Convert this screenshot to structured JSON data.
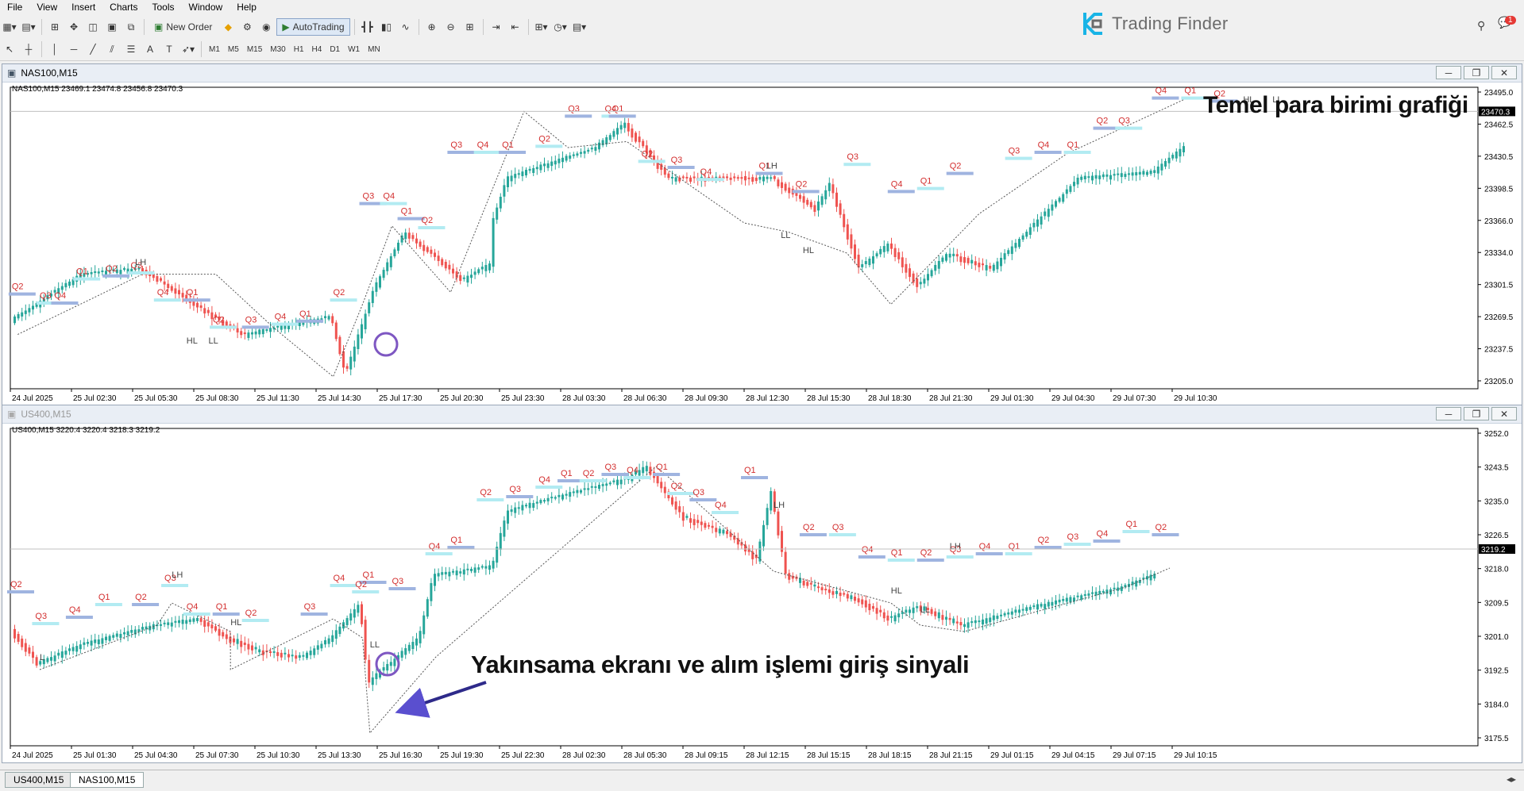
{
  "menu": [
    "File",
    "View",
    "Insert",
    "Charts",
    "Tools",
    "Window",
    "Help"
  ],
  "toolbar": {
    "new_order": "New Order",
    "auto_trading": "AutoTrading",
    "timeframes": [
      "M1",
      "M5",
      "M15",
      "M30",
      "H1",
      "H4",
      "D1",
      "W1",
      "MN"
    ]
  },
  "logo": {
    "text": "Trading Finder"
  },
  "notification_count": "1",
  "chart1": {
    "title": "NAS100,M15",
    "info": "NAS100,M15  23469.1 23474.8 23456.8 23470.3",
    "current_price": "23470.3",
    "y_ticks": [
      "23495.0",
      "23462.5",
      "23430.5",
      "23398.5",
      "23366.0",
      "23334.0",
      "23301.5",
      "23269.5",
      "23237.5",
      "23205.0"
    ],
    "x_ticks": [
      "24 Jul 2025",
      "25 Jul 02:30",
      "25 Jul 05:30",
      "25 Jul 08:30",
      "25 Jul 11:30",
      "25 Jul 14:30",
      "25 Jul 17:30",
      "25 Jul 20:30",
      "25 Jul 23:30",
      "28 Jul 03:30",
      "28 Jul 06:30",
      "28 Jul 09:30",
      "28 Jul 12:30",
      "28 Jul 15:30",
      "28 Jul 18:30",
      "28 Jul 21:30",
      "29 Jul 01:30",
      "29 Jul 04:30",
      "29 Jul 07:30",
      "29 Jul 10:30"
    ],
    "annotation": "Temel para birimi grafiği",
    "labels": [
      "Q2",
      "Q3",
      "Q4",
      "Q1",
      "Q2",
      "Q3",
      "LH",
      "Q4",
      "Q1",
      "Q2",
      "Q3",
      "Q4",
      "Q1",
      "Q2",
      "Q3",
      "Q4",
      "Q1",
      "Q2",
      "Q3",
      "Q4",
      "Q1",
      "Q2",
      "Q3",
      "Q4",
      "Q1",
      "Q2",
      "Q3",
      "Q4",
      "Q1",
      "LH",
      "Q2",
      "Q3",
      "Q4",
      "Q1",
      "Q2",
      "Q3",
      "Q4",
      "Q1",
      "Q2",
      "Q3",
      "Q4",
      "Q1",
      "Q2",
      "HL",
      "LL",
      "LL",
      "HL",
      "HL",
      "LL"
    ]
  },
  "chart2": {
    "title": "US400,M15",
    "info": "US400,M15  3220.4 3220.4 3218.3 3219.2",
    "current_price": "3219.2",
    "y_ticks": [
      "3252.0",
      "3243.5",
      "3235.0",
      "3226.5",
      "3218.0",
      "3209.5",
      "3201.0",
      "3192.5",
      "3184.0",
      "3175.5"
    ],
    "x_ticks": [
      "24 Jul 2025",
      "25 Jul 01:30",
      "25 Jul 04:30",
      "25 Jul 07:30",
      "25 Jul 10:30",
      "25 Jul 13:30",
      "25 Jul 16:30",
      "25 Jul 19:30",
      "25 Jul 22:30",
      "28 Jul 02:30",
      "28 Jul 05:30",
      "28 Jul 09:15",
      "28 Jul 12:15",
      "28 Jul 15:15",
      "28 Jul 18:15",
      "28 Jul 21:15",
      "29 Jul 01:15",
      "29 Jul 04:15",
      "29 Jul 07:15",
      "29 Jul 10:15"
    ],
    "annotation": "Yakınsama ekranı ve alım işlemi giriş sinyali",
    "labels": [
      "Q2",
      "Q3",
      "Q4",
      "Q1",
      "Q2",
      "Q3",
      "LH",
      "Q4",
      "Q1",
      "Q2",
      "Q3",
      "Q4",
      "Q1",
      "Q2",
      "Q3",
      "Q4",
      "Q1",
      "Q2",
      "Q3",
      "Q4",
      "Q1",
      "Q2",
      "Q3",
      "Q4",
      "Q1",
      "Q2",
      "Q3",
      "Q4",
      "Q1",
      "LH",
      "Q2",
      "Q3",
      "Q4",
      "Q1",
      "Q2",
      "Q3",
      "Q4",
      "Q1",
      "Q2",
      "Q3",
      "Q4",
      "Q1",
      "Q2",
      "L",
      "HL",
      "LL",
      "HL",
      "LL",
      "LH"
    ]
  },
  "tabs": [
    "US400,M15",
    "NAS100,M15"
  ],
  "colors": {
    "bull": "#26a69a",
    "bear": "#ef5350",
    "label": "#d32f2f",
    "zone_blue": "#9fb4e0",
    "zone_cyan": "#b2ebf2",
    "circle": "#7e57c2"
  }
}
